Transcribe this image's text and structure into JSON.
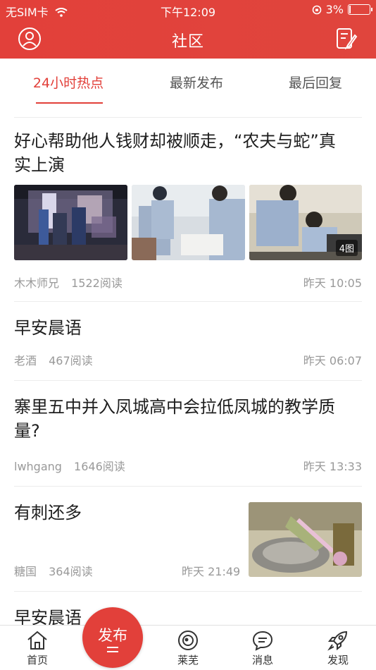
{
  "status_bar": {
    "carrier": "无SIM卡",
    "time": "下午12:09",
    "battery": "3%"
  },
  "header": {
    "title": "社区"
  },
  "tabs": [
    {
      "label": "24小时热点",
      "active": true
    },
    {
      "label": "最新发布",
      "active": false
    },
    {
      "label": "最后回复",
      "active": false
    }
  ],
  "posts": [
    {
      "title_line1": "好心帮助他人钱财却被顺走，“农夫与蛇”真",
      "title_line2": "实上演",
      "author": "木木师兄",
      "reads": "1522阅读",
      "time": "昨天 10:05",
      "image_count": "4图"
    },
    {
      "title_line1": "早安晨语",
      "author": "老酒",
      "reads": "467阅读",
      "time": "昨天 06:07"
    },
    {
      "title_line1": "寨里五中并入凤城高中会拉低凤城的教学质",
      "title_line2": "量?",
      "author": "lwhgang",
      "reads": "1646阅读",
      "time": "昨天 13:33"
    },
    {
      "title_line1": "有刺还多",
      "author": "糖国",
      "reads": "364阅读",
      "time": "昨天 21:49"
    },
    {
      "title_line1": "早安晨语"
    }
  ],
  "tabbar": {
    "home": "首页",
    "publish": "发布",
    "laiwu": "莱芜",
    "messages": "消息",
    "discover": "发现"
  },
  "colors": {
    "accent": "#e2403a"
  }
}
